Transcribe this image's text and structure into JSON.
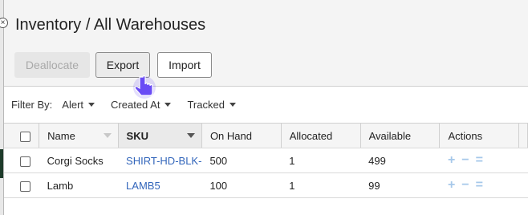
{
  "page": {
    "title": "Inventory / All Warehouses"
  },
  "toolbar": {
    "deallocate_label": "Deallocate",
    "export_label": "Export",
    "import_label": "Import"
  },
  "filters": {
    "label": "Filter By:",
    "items": [
      "Alert",
      "Created At",
      "Tracked"
    ]
  },
  "table": {
    "columns": [
      "Name",
      "SKU",
      "On Hand",
      "Allocated",
      "Available",
      "Actions"
    ],
    "sorted_column": "SKU",
    "rows": [
      {
        "name": "Corgi Socks",
        "sku": "SHIRT-HD-BLK-",
        "on_hand": "500",
        "allocated": "1",
        "available": "499"
      },
      {
        "name": "Lamb",
        "sku": "LAMB5",
        "on_hand": "100",
        "allocated": "1",
        "available": "99"
      }
    ]
  },
  "colors": {
    "link": "#3366bb",
    "action_icons": "#a6c8ea",
    "cursor": "#6a4cf5",
    "rail_accent": "#1d3b2a"
  },
  "icons": {
    "actions": [
      "plus-icon",
      "minus-icon",
      "equals-icon"
    ],
    "cursor": "hand-pointer-icon"
  }
}
